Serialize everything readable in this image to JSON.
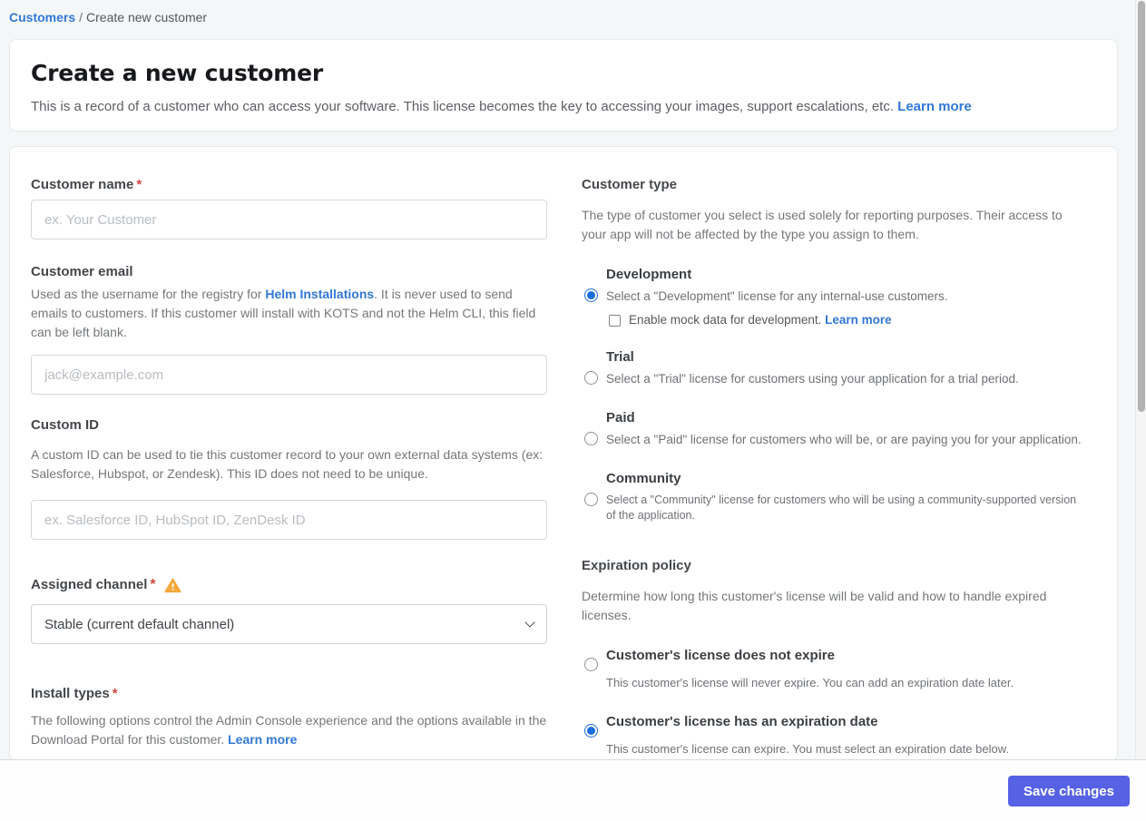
{
  "breadcrumb": {
    "link": "Customers",
    "separator": "/",
    "current": "Create new customer"
  },
  "header": {
    "title": "Create a new customer",
    "description": "This is a record of a customer who can access your software. This license becomes the key to accessing your images, support escalations, etc.",
    "learn_more": "Learn more"
  },
  "form": {
    "customer_name": {
      "label": "Customer name",
      "required": "*",
      "placeholder": "ex. Your Customer"
    },
    "customer_email": {
      "label": "Customer email",
      "desc_before": "Used as the username for the registry for ",
      "desc_link": "Helm Installations",
      "desc_after": ". It is never used to send emails to customers. If this customer will install with KOTS and not the Helm CLI, this field can be left blank.",
      "placeholder": "jack@example.com"
    },
    "custom_id": {
      "label": "Custom ID",
      "description": "A custom ID can be used to tie this customer record to your own external data systems (ex: Salesforce, Hubspot, or Zendesk). This ID does not need to be unique.",
      "placeholder": "ex. Salesforce ID, HubSpot ID, ZenDesk ID"
    },
    "assigned_channel": {
      "label": "Assigned channel",
      "required": "*",
      "selected_option": "Stable (current default channel)"
    },
    "install_types": {
      "label": "Install types",
      "required": "*",
      "description": "The following options control the Admin Console experience and the options available in the Download Portal for this customer. ",
      "learn_more": "Learn more"
    }
  },
  "customer_type": {
    "heading": "Customer type",
    "description": "The type of customer you select is used solely for reporting purposes. Their access to your app will not be affected by the type you assign to them.",
    "options": [
      {
        "title": "Development",
        "description": "Select a \"Development\" license for any internal-use customers.",
        "selected": true
      },
      {
        "title": "Trial",
        "description": "Select a \"Trial\" license for customers using your application for a trial period.",
        "selected": false
      },
      {
        "title": "Paid",
        "description": "Select a \"Paid\" license for customers who will be, or are paying you for your application.",
        "selected": false
      },
      {
        "title": "Community",
        "description": "Select a \"Community\" license for customers who will be using a community-supported version of the application.",
        "selected": false
      }
    ],
    "mock_data": {
      "label": "Enable mock data for development. ",
      "learn_more": "Learn more",
      "checked": false
    }
  },
  "expiration_policy": {
    "heading": "Expiration policy",
    "description": "Determine how long this customer's license will be valid and how to handle expired licenses.",
    "options": [
      {
        "title": "Customer's license does not expire",
        "description": "This customer's license will never expire. You can add an expiration date later.",
        "selected": false
      },
      {
        "title": "Customer's license has an expiration date",
        "description": "This customer's license can expire. You must select an expiration date below.",
        "selected": true
      }
    ]
  },
  "footer": {
    "save_button": "Save changes"
  },
  "colors": {
    "link_blue": "#3277d8",
    "radio_blue": "#1a6ee0",
    "button_indigo": "#5661e4",
    "warning_amber": "#f5a83c",
    "required_red": "#d0453f",
    "page_background": "#f4f7f8"
  }
}
